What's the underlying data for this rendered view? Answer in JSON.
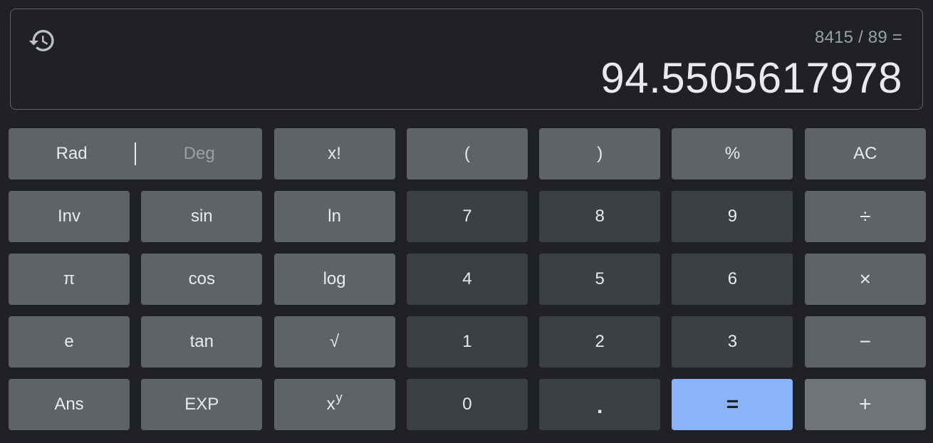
{
  "display": {
    "expression": "8415 / 89 =",
    "result": "94.5505617978"
  },
  "angle_mode": {
    "rad_label": "Rad",
    "deg_label": "Deg",
    "active": "Rad"
  },
  "keys": {
    "factorial": "x!",
    "open_paren": "(",
    "close_paren": ")",
    "percent": "%",
    "clear": "AC",
    "inv": "Inv",
    "sin": "sin",
    "ln": "ln",
    "seven": "7",
    "eight": "8",
    "nine": "9",
    "divide": "÷",
    "pi": "π",
    "cos": "cos",
    "log": "log",
    "four": "4",
    "five": "5",
    "six": "6",
    "multiply": "×",
    "e": "e",
    "tan": "tan",
    "sqrt": "√",
    "one": "1",
    "two": "2",
    "three": "3",
    "minus": "−",
    "ans": "Ans",
    "exp": "EXP",
    "power_base": "x",
    "power_exp": "y",
    "zero": "0",
    "decimal": ".",
    "equals": "=",
    "plus": "+"
  },
  "icons": {
    "history": "history-icon"
  },
  "colors": {
    "background": "#202124",
    "function_key": "#5f6368",
    "number_key": "#3c4043",
    "equals_key": "#8ab4f8",
    "text": "#e8eaed",
    "muted_text": "#9aa0a6"
  }
}
